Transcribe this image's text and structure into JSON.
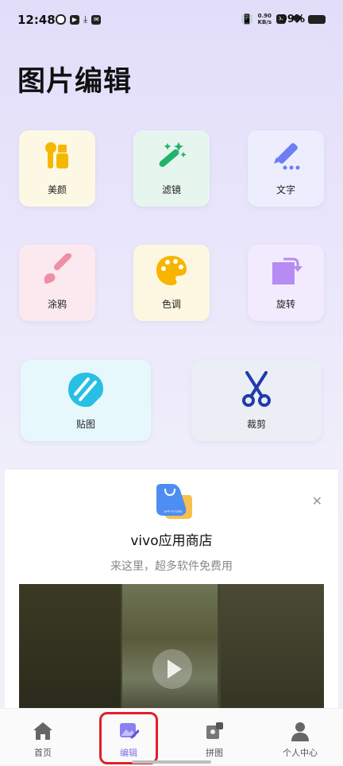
{
  "status_bar": {
    "time": "12:48",
    "net_speed_value": "0.90",
    "net_speed_unit": "KB/s",
    "battery": "99%"
  },
  "page_title": "图片编辑",
  "tools": [
    {
      "label": "美颜",
      "icon": "beauty-icon",
      "bg": "#fdf8e3",
      "color": "#f5b800"
    },
    {
      "label": "滤镜",
      "icon": "magic-wand-icon",
      "bg": "#e6f6ef",
      "color": "#22b36a"
    },
    {
      "label": "文字",
      "icon": "pen-text-icon",
      "bg": "#eceefd",
      "color": "#6f7df2"
    },
    {
      "label": "涂鸦",
      "icon": "brush-icon",
      "bg": "#fbe9ef",
      "color": "#ef8fa6"
    },
    {
      "label": "色调",
      "icon": "palette-icon",
      "bg": "#fdf7e1",
      "color": "#f7b500"
    },
    {
      "label": "旋转",
      "icon": "rotate-icon",
      "bg": "#f2ebfd",
      "color": "#b68cf2"
    },
    {
      "label": "贴图",
      "icon": "sticker-icon",
      "bg": "#e6f8fc",
      "color": "#27bfe3"
    },
    {
      "label": "裁剪",
      "icon": "scissors-icon",
      "bg": "#eceef6",
      "color": "#1f3ca8"
    }
  ],
  "ad": {
    "title": "vivo应用商店",
    "subtitle": "来这里，超多软件免费用",
    "logo_text": "APP STORE",
    "close_icon": "close-icon"
  },
  "nav": [
    {
      "label": "首页",
      "icon": "home-icon"
    },
    {
      "label": "编辑",
      "icon": "edit-image-icon",
      "active": true
    },
    {
      "label": "拼图",
      "icon": "puzzle-icon"
    },
    {
      "label": "个人中心",
      "icon": "person-icon"
    }
  ],
  "colors": {
    "accent": "#7f71e6",
    "highlight": "#e0202a"
  }
}
